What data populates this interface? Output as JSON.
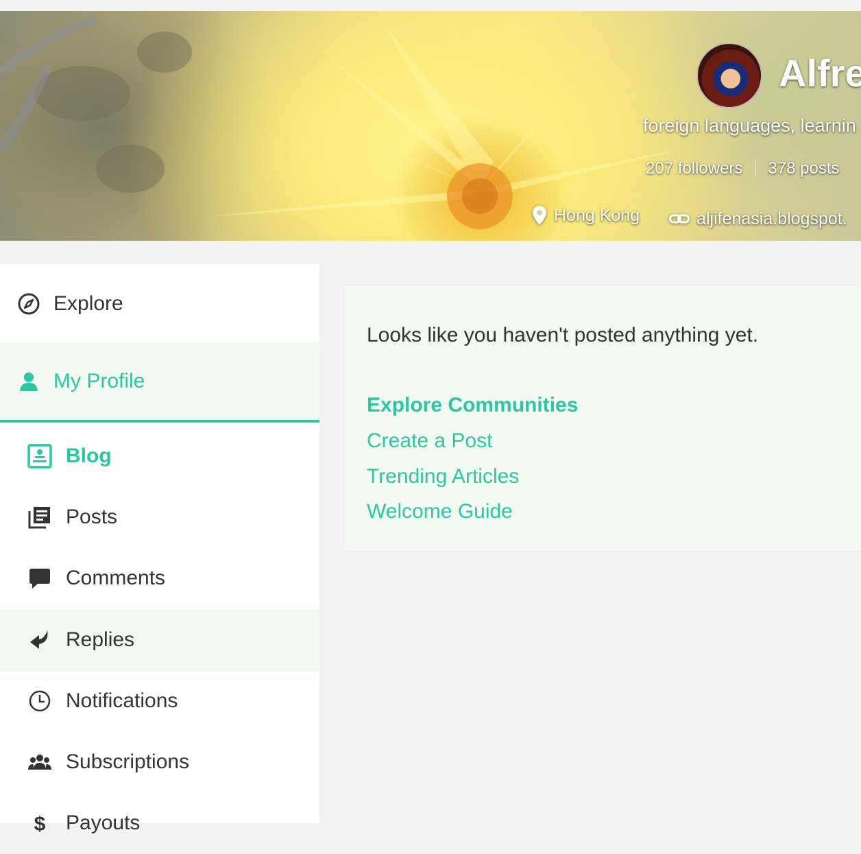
{
  "profile": {
    "name": "Alfre",
    "about": "foreign languages, learnin",
    "followers": "207 followers",
    "posts_count": "378 posts",
    "location": "Hong Kong",
    "website": "aljifenasia.blogspot."
  },
  "sidebar": {
    "explore": "Explore",
    "my_profile": "My Profile",
    "items": [
      {
        "label": "Blog",
        "icon": "blog-icon"
      },
      {
        "label": "Posts",
        "icon": "posts-icon"
      },
      {
        "label": "Comments",
        "icon": "comment-icon"
      },
      {
        "label": "Replies",
        "icon": "reply-icon"
      },
      {
        "label": "Notifications",
        "icon": "clock-icon"
      },
      {
        "label": "Subscriptions",
        "icon": "people-icon"
      },
      {
        "label": "Payouts",
        "icon": "dollar-icon"
      }
    ]
  },
  "main": {
    "empty_message": "Looks like you haven't posted anything yet.",
    "links": {
      "explore_communities": "Explore Communities",
      "create_post": "Create a Post",
      "trending_articles": "Trending Articles",
      "welcome_guide": "Welcome Guide"
    }
  },
  "colors": {
    "accent": "#2cc7a2",
    "active_bg": "#f1f9f0",
    "text": "#333333"
  }
}
